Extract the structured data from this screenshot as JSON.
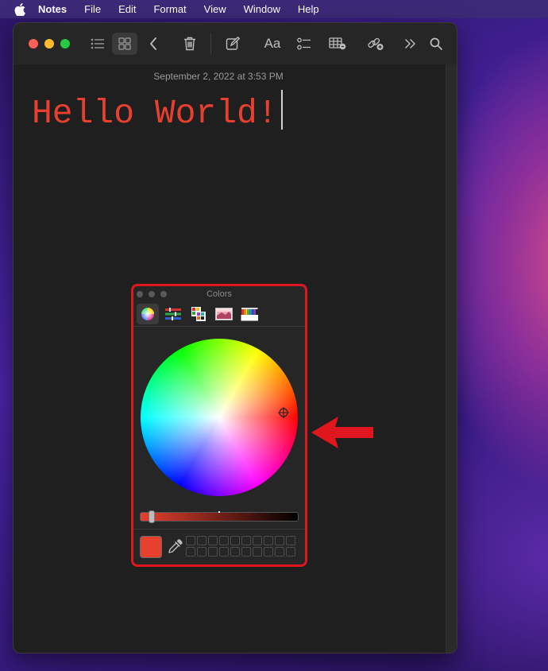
{
  "menubar": {
    "apple": "apple-icon",
    "items": [
      "Notes",
      "File",
      "Edit",
      "Format",
      "View",
      "Window",
      "Help"
    ]
  },
  "toolbar": {
    "font_button": "Aa",
    "icons": [
      "list-view-icon",
      "gallery-view-icon",
      "back-icon",
      "trash-icon",
      "compose-icon",
      "format-icon",
      "checklist-icon",
      "table-icon",
      "collaborate-icon",
      "more-icon",
      "search-icon"
    ]
  },
  "note": {
    "date": "September 2, 2022 at 3:53 PM",
    "text": "Hello World!",
    "text_color": "#e8402e"
  },
  "colors_panel": {
    "title": "Colors",
    "tabs": [
      "color-wheel-tab",
      "color-sliders-tab",
      "color-palettes-tab",
      "image-palettes-tab",
      "pencils-tab"
    ],
    "selected_color": "#e8402e",
    "brightness": 0.95,
    "border_color": "#e0161e"
  },
  "annotation": {
    "arrow": "red-pointer-arrow",
    "color": "#e0161e"
  }
}
